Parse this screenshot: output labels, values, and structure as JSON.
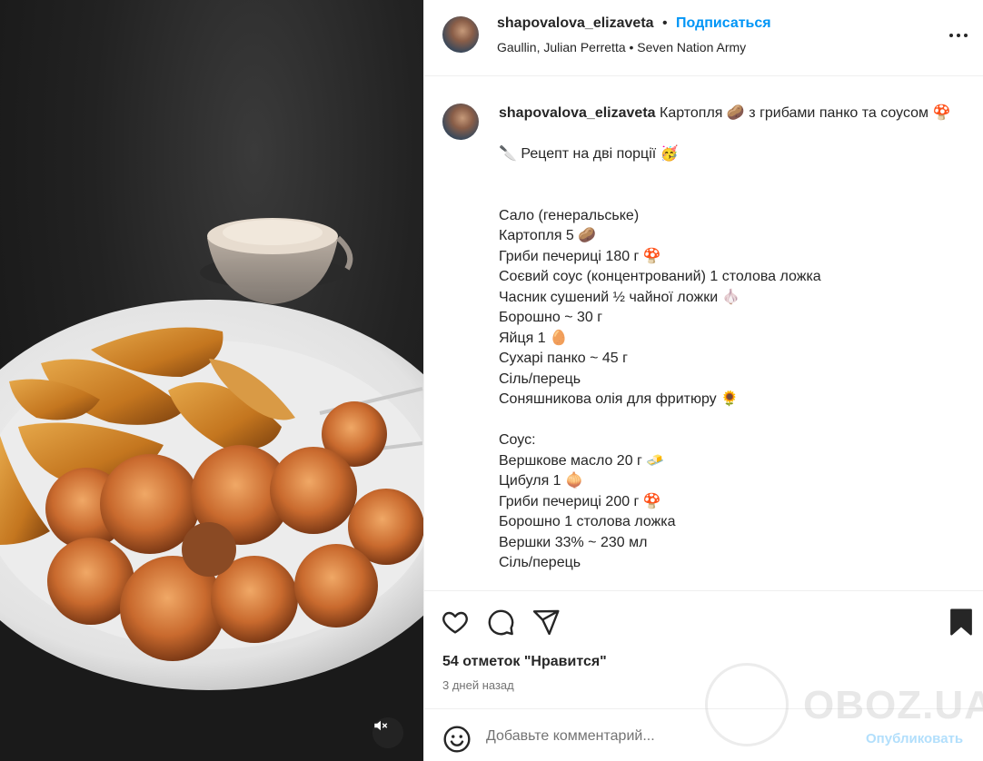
{
  "post": {
    "username": "shapovalova_elizaveta",
    "follow_label": "Подписаться",
    "separator": "•",
    "music": "Gaullin, Julian Perretta • Seven Nation Army",
    "more_icon": "more-horizontal-icon"
  },
  "caption": {
    "username": "shapovalova_elizaveta",
    "title": " Картопля 🥔 з грибами панко та соусом 🍄",
    "lines": [
      "🔪 Рецепт на дві порції 🥳",
      "",
      "Сало (генеральське)",
      "Картопля 5 🥔",
      "Гриби печериці 180 г 🍄",
      "Соєвий соус (концентрований) 1 столова ложка",
      "Часник сушений ½ чайної ложки 🧄",
      "Борошно ~ 30 г",
      "Яйця 1 🥚",
      "Сухарі панко ~ 45 г",
      "Сіль/перець",
      "Соняшникова олія для фритюру 🌻",
      "",
      "Соус:",
      "Вершкове масло 20 г 🧈",
      "Цибуля 1 🧅",
      "Гриби печериці 200 г 🍄",
      "Борошно 1 столова ложка",
      "Вершки 33% ~ 230 мл",
      "Сіль/перець"
    ]
  },
  "actions": {
    "icons": [
      "heart-icon",
      "comment-icon",
      "share-icon",
      "bookmark-icon"
    ],
    "likes": "54 отметок \"Нравится\"",
    "date": "3 дней назад"
  },
  "comment": {
    "placeholder": "Добавьте комментарий...",
    "publish_label": "Опубликовать",
    "emoji_icon": "smile-icon"
  },
  "media": {
    "mute_icon": "mute-icon"
  },
  "watermark": {
    "text": "OBOZ.UA"
  },
  "colors": {
    "accent": "#0095f6",
    "text": "#262626",
    "secondary": "#737373",
    "divider": "#efefef"
  }
}
